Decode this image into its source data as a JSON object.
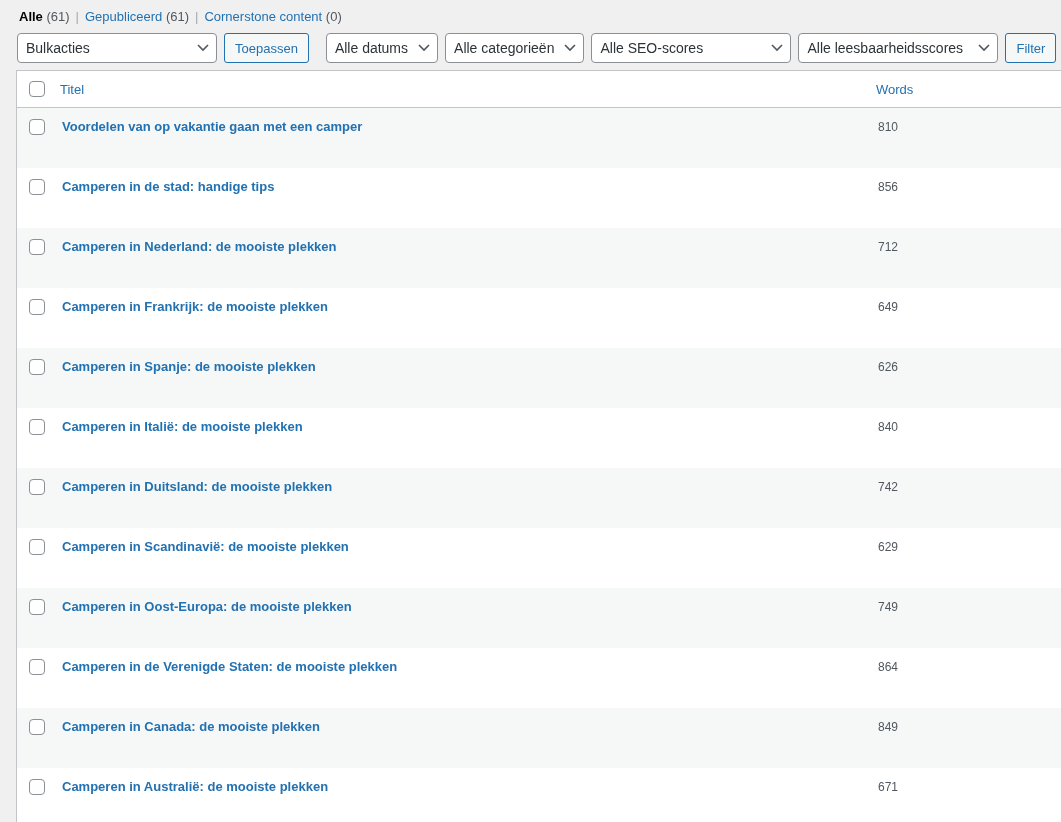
{
  "views": [
    {
      "label": "Alle",
      "count": "(61)",
      "selected": true
    },
    {
      "separator": "|",
      "label": "Gepubliceerd",
      "count": "(61)",
      "selected": false
    },
    {
      "separator": "|",
      "label": "Cornerstone content",
      "count": "(0)",
      "selected": false
    }
  ],
  "toolbar": [
    {
      "kind": "select",
      "label": "Bulkacties"
    },
    {
      "kind": "button",
      "label": "Toepassen"
    },
    {
      "kind": "select",
      "label": "Alle datums"
    },
    {
      "kind": "select",
      "label": "Alle categorieën"
    },
    {
      "kind": "select",
      "label": "Alle SEO-scores"
    },
    {
      "kind": "select",
      "label": "Alle leesbaarheidsscores"
    },
    {
      "kind": "button",
      "label": "Filter"
    }
  ],
  "table": {
    "select_all_checked": false,
    "columns": [
      "Titel",
      "Words"
    ],
    "rows": [
      {
        "title": "Voordelen van op vakantie gaan met een camper",
        "words": "810",
        "checked": false
      },
      {
        "title": "Camperen in de stad: handige tips",
        "words": "856",
        "checked": false
      },
      {
        "title": "Camperen in Nederland: de mooiste plekken",
        "words": "712",
        "checked": false
      },
      {
        "title": "Camperen in Frankrijk: de mooiste plekken",
        "words": "649",
        "checked": false
      },
      {
        "title": "Camperen in Spanje: de mooiste plekken",
        "words": "626",
        "checked": false
      },
      {
        "title": "Camperen in Italië: de mooiste plekken",
        "words": "840",
        "checked": false
      },
      {
        "title": "Camperen in Duitsland: de mooiste plekken",
        "words": "742",
        "checked": false
      },
      {
        "title": "Camperen in Scandinavië: de mooiste plekken",
        "words": "629",
        "checked": false
      },
      {
        "title": "Camperen in Oost-Europa: de mooiste plekken",
        "words": "749",
        "checked": false
      },
      {
        "title": "Camperen in de Verenigde Staten: de mooiste plekken",
        "words": "864",
        "checked": false
      },
      {
        "title": "Camperen in Canada: de mooiste plekken",
        "words": "849",
        "checked": false
      },
      {
        "title": "Camperen in Australië: de mooiste plekken",
        "words": "671",
        "checked": false
      }
    ]
  }
}
